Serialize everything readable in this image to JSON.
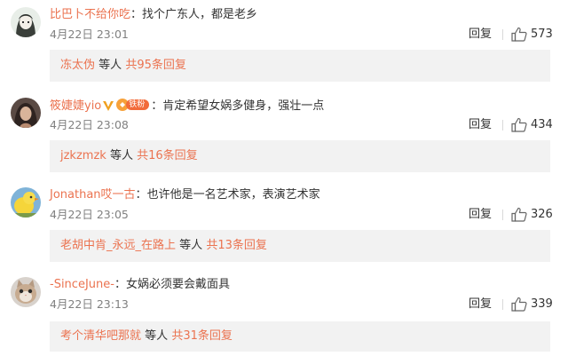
{
  "comments": [
    {
      "username": "比巴卜不给你吃",
      "colon": "：",
      "text": "找个广东人，都是老乡",
      "time": "4月22日 23:01",
      "reply_label": "回复",
      "likes": "573",
      "replies_user": "冻太伪",
      "replies_etc": "等人",
      "replies_total": "共95条回复",
      "avatar": "avatar-anime-girl"
    },
    {
      "username": "筱婕婕yio",
      "colon": "：",
      "text": "肯定希望女娲多健身，强壮一点",
      "time": "4月22日 23:08",
      "reply_label": "回复",
      "likes": "434",
      "replies_user": "jzkzmzk",
      "replies_etc": "等人",
      "replies_total": "共16条回复",
      "avatar": "avatar-photo-girl",
      "badge_vip": "verified-v-icon",
      "badge_fan": "铁粉"
    },
    {
      "username": "Jonathan哎一古",
      "colon": "：",
      "text": "也许他是一名艺术家，表演艺术家",
      "time": "4月22日 23:05",
      "reply_label": "回复",
      "likes": "326",
      "replies_user": "老胡中肯_永远_在路上",
      "replies_etc": "等人",
      "replies_total": "共13条回复",
      "avatar": "avatar-yellow-chick"
    },
    {
      "username": "-SinceJune-",
      "colon": "：",
      "text": "女娲必须要会戴面具",
      "time": "4月22日 23:13",
      "reply_label": "回复",
      "likes": "339",
      "replies_user": "考个清华吧那就",
      "replies_etc": "等人",
      "replies_total": "共31条回复",
      "avatar": "avatar-cat"
    }
  ],
  "colors": {
    "username": "#eb7350",
    "reply_box_bg": "#f2f2f2",
    "meta": "#808080"
  }
}
